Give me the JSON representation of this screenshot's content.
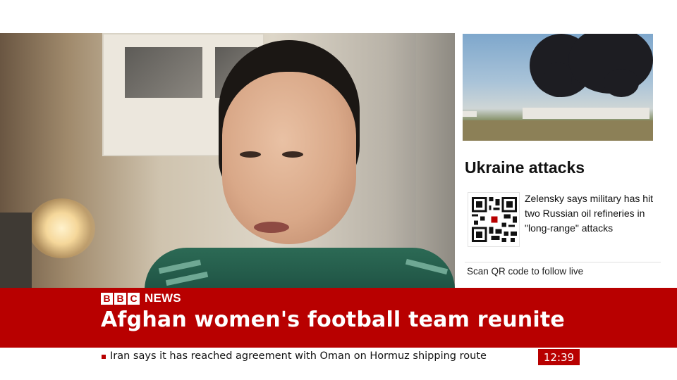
{
  "side_panel": {
    "heading": "Ukraine attacks",
    "story": "Zelensky says military has hit two Russian oil refineries in \"long-range\" attacks",
    "qr_caption": "Scan QR code to follow live"
  },
  "banner": {
    "brand": {
      "letters": [
        "B",
        "B",
        "C"
      ],
      "label": "NEWS"
    },
    "headline": "Afghan women's football team reunite"
  },
  "ticker": {
    "text": "Iran says it has reached agreement with Oman on Hormuz shipping route",
    "time": "12:39"
  },
  "colors": {
    "brand_red": "#b80000",
    "text_dark": "#111111",
    "white": "#ffffff"
  },
  "icons": {
    "qr": "qr-code-icon",
    "bullet": "ticker-bullet-icon"
  }
}
